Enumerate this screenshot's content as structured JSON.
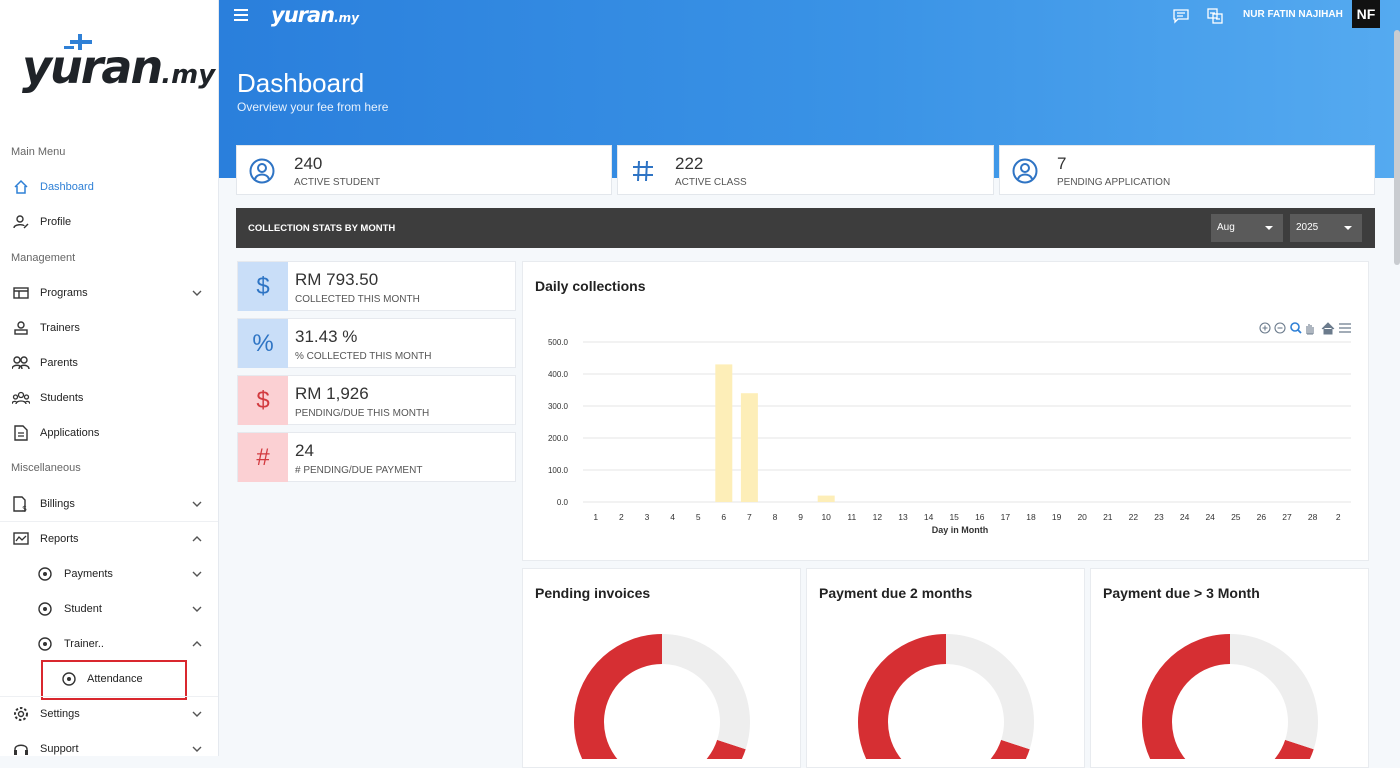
{
  "brand": {
    "logo_main": "yuran",
    "logo_suffix": ".my"
  },
  "topbar": {
    "user_name": "NUR FATIN NAJIHAH",
    "avatar_initials": "NF"
  },
  "page": {
    "title": "Dashboard",
    "subtitle": "Overview your fee from here"
  },
  "sidebar": {
    "sections": {
      "main": "Main Menu",
      "management": "Management",
      "misc": "Miscellaneous"
    },
    "items": [
      {
        "label": "Dashboard"
      },
      {
        "label": "Profile"
      },
      {
        "label": "Programs"
      },
      {
        "label": "Trainers"
      },
      {
        "label": "Parents"
      },
      {
        "label": "Students"
      },
      {
        "label": "Applications"
      },
      {
        "label": "Billings"
      },
      {
        "label": "Reports"
      },
      {
        "label": "Payments"
      },
      {
        "label": "Student"
      },
      {
        "label": "Trainer.."
      },
      {
        "label": "Attendance"
      },
      {
        "label": "Settings"
      },
      {
        "label": "Support"
      }
    ]
  },
  "stats": [
    {
      "value": "240",
      "label": "ACTIVE STUDENT"
    },
    {
      "value": "222",
      "label": "ACTIVE CLASS"
    },
    {
      "value": "7",
      "label": "PENDING APPLICATION"
    }
  ],
  "collection": {
    "title": "COLLECTION STATS BY MONTH",
    "month": "Aug",
    "year": "2025",
    "cards": [
      {
        "icon": "$",
        "value": "RM 793.50",
        "label": "COLLECTED THIS MONTH"
      },
      {
        "icon": "%",
        "value": "31.43 %",
        "label": "% COLLECTED THIS MONTH"
      },
      {
        "icon": "$",
        "value": "RM 1,926",
        "label": "PENDING/DUE THIS MONTH"
      },
      {
        "icon": "#",
        "value": "24",
        "label": "# PENDING/DUE PAYMENT"
      }
    ]
  },
  "colors": {
    "accent": "#2a7fdc",
    "bar": "#fdeeb8",
    "donut_red": "#d62f33",
    "donut_grey": "#eeeeee"
  },
  "chart_data": [
    {
      "type": "bar",
      "title": "Daily collections",
      "xlabel": "Day in Month",
      "ylabel": "",
      "ylim": [
        0,
        500
      ],
      "yticks": [
        "0.0",
        "100.0",
        "200.0",
        "300.0",
        "400.0",
        "500.0"
      ],
      "categories": [
        "1",
        "2",
        "3",
        "4",
        "5",
        "6",
        "7",
        "8",
        "9",
        "10",
        "11",
        "12",
        "13",
        "14",
        "15",
        "16",
        "17",
        "18",
        "19",
        "20",
        "21",
        "22",
        "23",
        "24",
        "24",
        "25",
        "26",
        "27",
        "28",
        "2"
      ],
      "values": [
        0,
        0,
        0,
        0,
        0,
        430,
        340,
        0,
        0,
        20,
        0,
        0,
        0,
        0,
        0,
        0,
        0,
        0,
        0,
        0,
        0,
        0,
        0,
        0,
        0,
        0,
        0,
        0,
        0,
        0
      ],
      "grid": true
    },
    {
      "type": "pie",
      "title": "Pending invoices",
      "values": [
        0.7,
        0.3
      ]
    },
    {
      "type": "pie",
      "title": "Payment due 2 months",
      "values": [
        0.7,
        0.3
      ]
    },
    {
      "type": "pie",
      "title": "Payment due > 3 Month",
      "values": [
        0.7,
        0.3
      ]
    }
  ]
}
